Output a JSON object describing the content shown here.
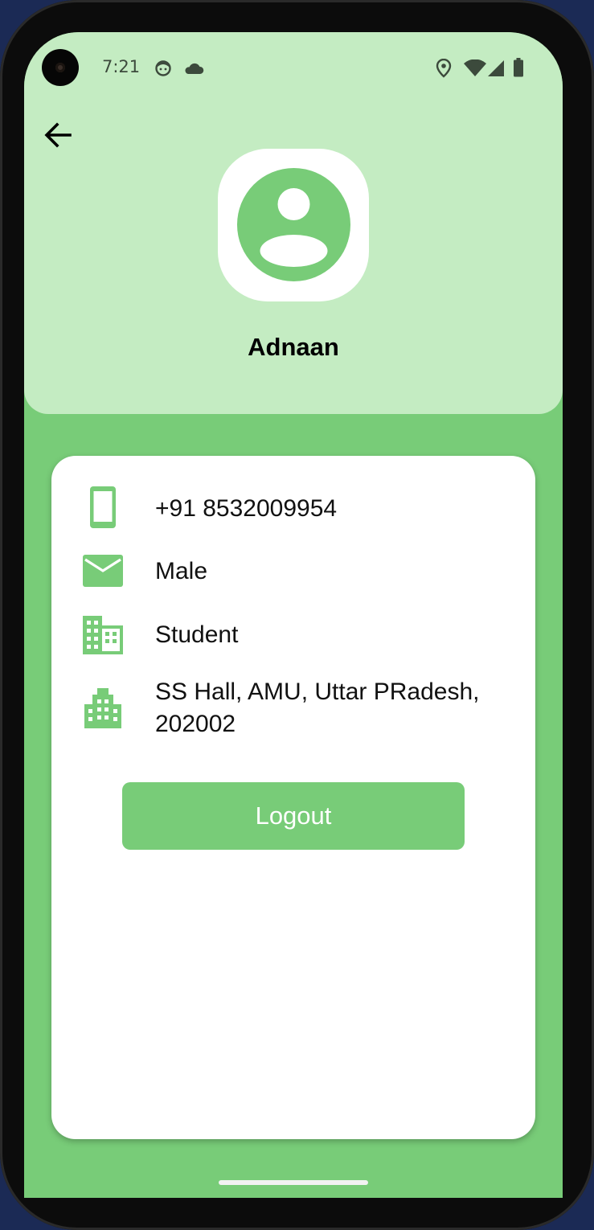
{
  "status_bar": {
    "time": "7:21",
    "left_icons": [
      "notification-face-icon",
      "cloud-icon"
    ],
    "right_icons": [
      "location-pin-icon",
      "wifi-icon",
      "signal-icon",
      "battery-icon"
    ]
  },
  "header": {
    "back_icon": "arrow-left-icon",
    "avatar_icon": "account-circle-icon",
    "user_name": "Adnaan"
  },
  "profile": {
    "items": [
      {
        "icon": "smartphone-icon",
        "value": "+91 8532009954"
      },
      {
        "icon": "mail-icon",
        "value": "Male"
      },
      {
        "icon": "building-icon",
        "value": "Student"
      },
      {
        "icon": "apartment-icon",
        "value": "SS Hall, AMU, Uttar PRadesh, 202002"
      }
    ],
    "logout_label": "Logout"
  },
  "colors": {
    "header_bg": "#c4ecc2",
    "accent_green": "#78cc78",
    "card_bg": "#ffffff",
    "text": "#111111"
  }
}
